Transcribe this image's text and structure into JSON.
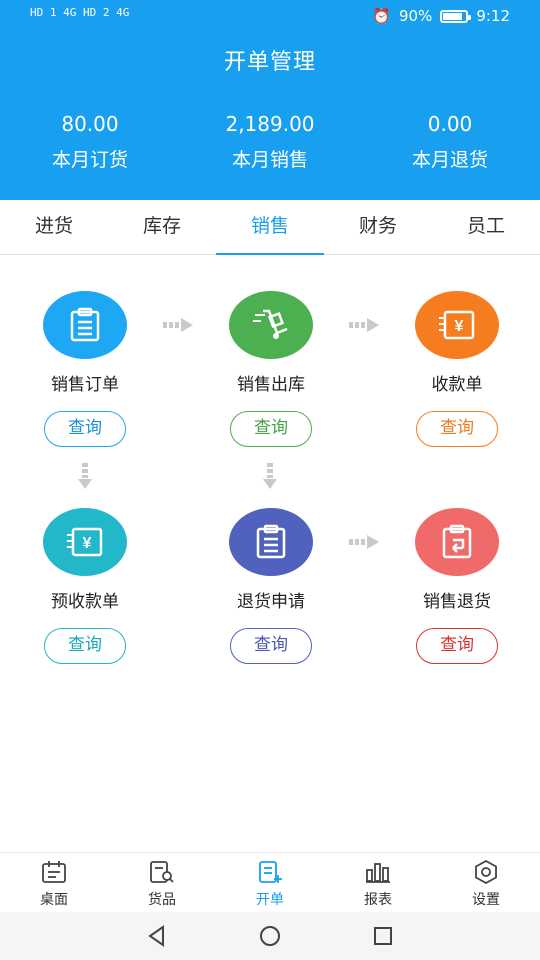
{
  "status": {
    "sim": "HD 1 4G  HD 2 4G",
    "battery": "90%",
    "time": "9:12"
  },
  "header": {
    "title": "开单管理"
  },
  "stats": [
    {
      "value": "80.00",
      "label": "本月订货"
    },
    {
      "value": "2,189.00",
      "label": "本月销售"
    },
    {
      "value": "0.00",
      "label": "本月退货"
    }
  ],
  "tabs": [
    "进货",
    "库存",
    "销售",
    "财务",
    "员工"
  ],
  "active_tab": "销售",
  "flow": [
    {
      "name": "销售订单",
      "button": "查询",
      "icon": "clipboard-icon",
      "color": "#1ea7f2",
      "text_color": "#1b8fd6"
    },
    {
      "name": "销售出库",
      "button": "查询",
      "icon": "hand-truck-icon",
      "color": "#4caf50",
      "text_color": "#43a047"
    },
    {
      "name": "收款单",
      "button": "查询",
      "icon": "yen-receipt-icon",
      "color": "#f57c1f",
      "text_color": "#ef7a1a"
    },
    {
      "name": "预收款单",
      "button": "查询",
      "icon": "yen-receipt-icon",
      "color": "#22b8c9",
      "text_color": "#19a7b8"
    },
    {
      "name": "退货申请",
      "button": "查询",
      "icon": "clipboard-icon",
      "color": "#5062bd",
      "text_color": "#4857b3"
    },
    {
      "name": "销售退货",
      "button": "查询",
      "icon": "return-clipboard-icon",
      "color": "#f06a6a",
      "text_color": "#d63333"
    }
  ],
  "bottom_nav": [
    {
      "label": "桌面",
      "icon": "calendar-icon"
    },
    {
      "label": "货品",
      "icon": "search-doc-icon"
    },
    {
      "label": "开单",
      "icon": "new-order-icon",
      "active": true
    },
    {
      "label": "报表",
      "icon": "bar-chart-icon"
    },
    {
      "label": "设置",
      "icon": "gear-icon"
    }
  ],
  "system_nav": [
    "back-icon",
    "home-icon",
    "recent-icon"
  ]
}
